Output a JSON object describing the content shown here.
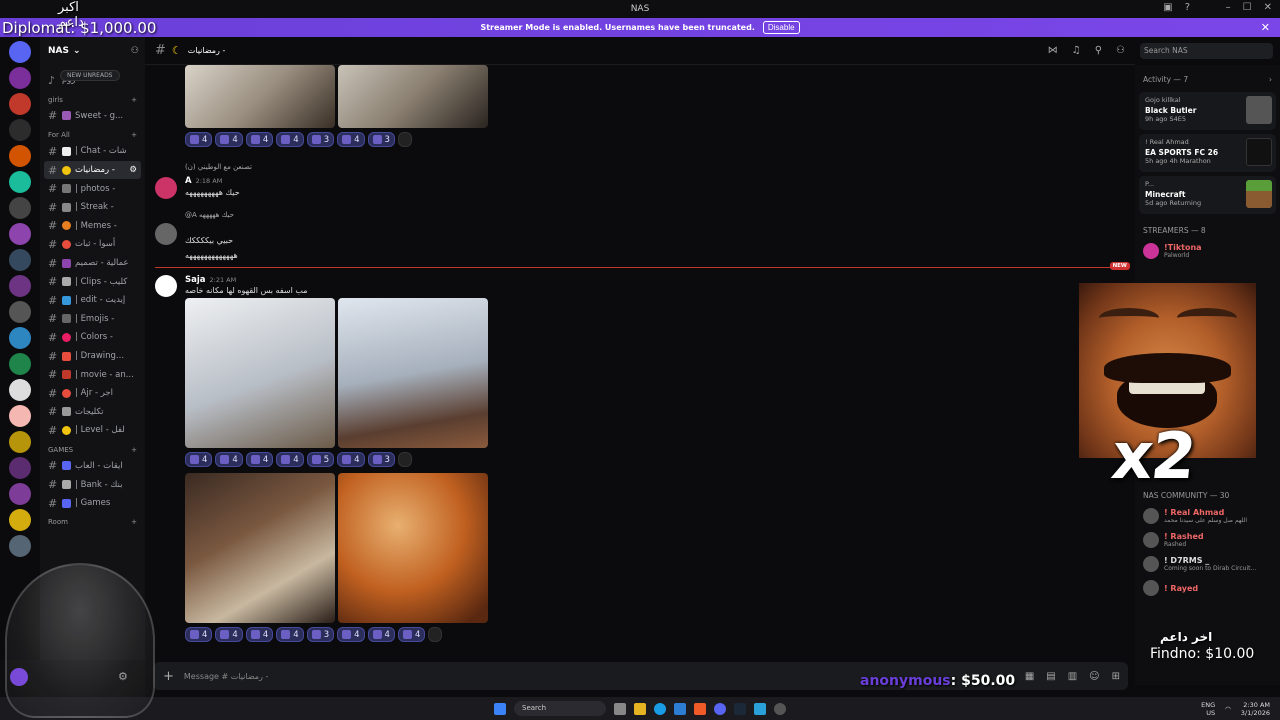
{
  "window": {
    "title": "NAS"
  },
  "banner": {
    "text": "Streamer Mode is enabled. Usernames have been truncated.",
    "disable_label": "Disable"
  },
  "overlay": {
    "arabic_top": "اكبر داعم",
    "diplomat": "Diplomat: $1,000.00"
  },
  "server": {
    "name": "NAS"
  },
  "new_unreads": "NEW UNREADS",
  "channels": {
    "categories": {
      "girls": "girls",
      "forall": "For All",
      "games": "GAMES",
      "room": "Room"
    },
    "girls_items": [
      {
        "label": "Sweet - g..."
      }
    ],
    "forall_items": [
      {
        "label": "| Chat - شات",
        "active": false
      },
      {
        "label": "رمضانيات -",
        "active": true
      },
      {
        "label": "| photos -",
        "active": false
      },
      {
        "label": "| Streak -",
        "active": false
      },
      {
        "label": "| Memes -",
        "active": false
      },
      {
        "label": "أسوا - ثبات",
        "active": false
      },
      {
        "label": "عمالية - تصميم",
        "active": false
      },
      {
        "label": "| Clips - كليب",
        "active": false
      },
      {
        "label": "| edit - إيديت",
        "active": false
      },
      {
        "label": "| Emojis -",
        "active": false
      },
      {
        "label": "| Colors -",
        "active": false
      },
      {
        "label": "| Drawing...",
        "active": false
      },
      {
        "label": "| movie - an...",
        "active": false
      },
      {
        "label": "| Ajr - اجر",
        "active": false
      },
      {
        "label": "تكليجات",
        "active": false
      },
      {
        "label": "| Level - لفل",
        "active": false
      }
    ],
    "games_items": [
      {
        "label": "ايقات - العاب"
      },
      {
        "label": "| Bank - بنك"
      },
      {
        "label": "| Games"
      }
    ]
  },
  "channel_header": {
    "title": "رمضانيات -"
  },
  "search": {
    "placeholder": "Search NAS"
  },
  "messages": {
    "reply1": "(ن) تصنعن مع الوطيني",
    "msg1_author": "A",
    "msg1_time": "2:18 AM",
    "msg1_text": "حيك هههههههههه",
    "reply2": "@A حيك هههههه",
    "msg2_text1": "حبيي بيككككك",
    "msg2_text2": "هههههههههههههه",
    "new_label": "NEW",
    "msg3_author": "Saja",
    "msg3_time": "2:21 AM",
    "msg3_text": "مب اسفه بس القهوه لها مكانه خاصه",
    "reactions_row1": [
      "4",
      "4",
      "4",
      "4",
      "3",
      "4",
      "3"
    ],
    "reactions_row2": [
      "4",
      "4",
      "4",
      "4",
      "5",
      "4",
      "3"
    ],
    "reactions_row3": [
      "4",
      "4",
      "4",
      "4",
      "3",
      "4",
      "4",
      "4"
    ]
  },
  "composer": {
    "placeholder": "Message # رمضانيات -"
  },
  "activity": {
    "head": "Activity — 7",
    "cards": [
      {
        "user": "Gojo killkal",
        "game": "Black Butler",
        "meta": "9h ago  S4E5"
      },
      {
        "user": "! Real Ahmad",
        "game": "EA SPORTS FC 26",
        "meta": "5h ago  4h Marathon"
      },
      {
        "user": "P...",
        "game": "Minecraft",
        "meta": "5d ago  Returning"
      }
    ]
  },
  "streamers_head": "STREAMERS — 8",
  "streamers": [
    {
      "name": "!Tiktona",
      "sub": "Palworld"
    }
  ],
  "community_head": "NAS COMMUNITY — 30",
  "community": [
    {
      "name": "! Real Ahmad",
      "sub": "اللهم صل وسلم على سيدنا محمد"
    },
    {
      "name": "! Rashed",
      "sub": "Rashed"
    },
    {
      "name": "! D7RMS _",
      "sub": "Coming soon to Dirab Circuit..."
    },
    {
      "name": "! Rayed",
      "sub": ""
    }
  ],
  "donations": {
    "anonymous": "anonymous",
    "anonymous_amount": ": $50.00",
    "arabic_bottom": "اخر داعم",
    "findno": "Findno: $10.00"
  },
  "face_overlay": {
    "multiplier": "x2"
  },
  "taskbar": {
    "search": "Search",
    "lang": "ENG",
    "region": "US",
    "time": "2:30 AM",
    "date": "3/1/2026"
  },
  "colors": {
    "accent": "#7b46e8",
    "reaction_bg": "#2b2d5a",
    "new_line": "#c0392b"
  }
}
